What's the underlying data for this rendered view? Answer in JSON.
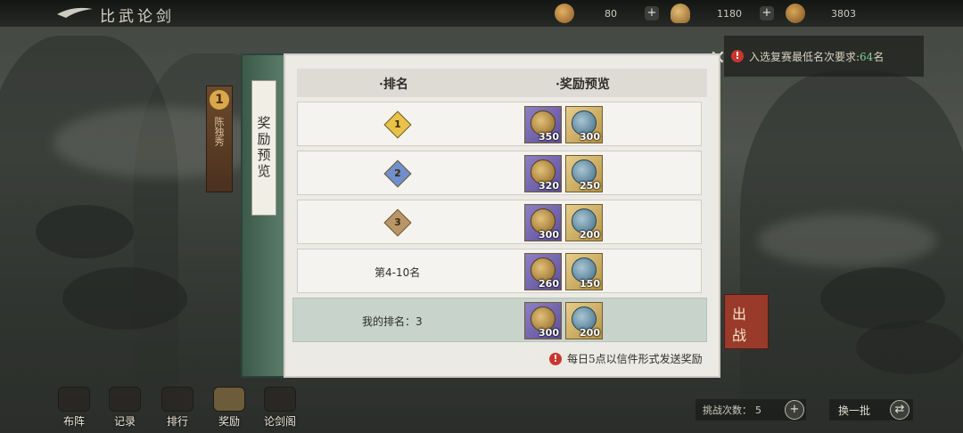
{
  "top_bar": {
    "title": "比武论剑",
    "resources": [
      {
        "icon": "leaf-currency-icon",
        "value": "80",
        "color": "#c08a3c"
      },
      {
        "icon": "hat-currency-icon",
        "value": "1180",
        "color": "#c7924a"
      },
      {
        "icon": "sword-token-icon",
        "value": "3803",
        "color": "#b5823c"
      }
    ]
  },
  "side_rank": {
    "number": "1",
    "name": "陈独秀"
  },
  "notice": {
    "prefix": "入选复赛最低名次要求:",
    "value": "64",
    "suffix": "名"
  },
  "battle_button": {
    "line1": "出",
    "line2": "战"
  },
  "modal": {
    "side_tab": "奖励预览",
    "headers": {
      "rank": "·排名",
      "reward": "·奖励预览"
    },
    "rows": [
      {
        "rank_type": "medal",
        "rank": "1",
        "medal_color": "#e9c24a",
        "rewards": [
          "350",
          "300"
        ]
      },
      {
        "rank_type": "medal",
        "rank": "2",
        "medal_color": "#6f8fce",
        "rewards": [
          "320",
          "250"
        ]
      },
      {
        "rank_type": "medal",
        "rank": "3",
        "medal_color": "#b9966a",
        "rewards": [
          "300",
          "200"
        ]
      },
      {
        "rank_type": "text",
        "rank": "第4-10名",
        "rewards": [
          "260",
          "150"
        ]
      }
    ],
    "my_rank": {
      "label": "我的排名：3",
      "rewards": [
        "300",
        "200"
      ]
    },
    "footer": "每日5点以信件形式发送奖励"
  },
  "bottom_nav": [
    {
      "label": "布阵",
      "icon": "formation-icon"
    },
    {
      "label": "记录",
      "icon": "record-icon"
    },
    {
      "label": "排行",
      "icon": "ranking-icon"
    },
    {
      "label": "奖励",
      "icon": "reward-icon"
    },
    {
      "label": "论剑阁",
      "icon": "pavilion-icon"
    }
  ],
  "challenge": {
    "label": "挑战次数：",
    "value": "5"
  },
  "refresh": {
    "label": "换一批"
  }
}
